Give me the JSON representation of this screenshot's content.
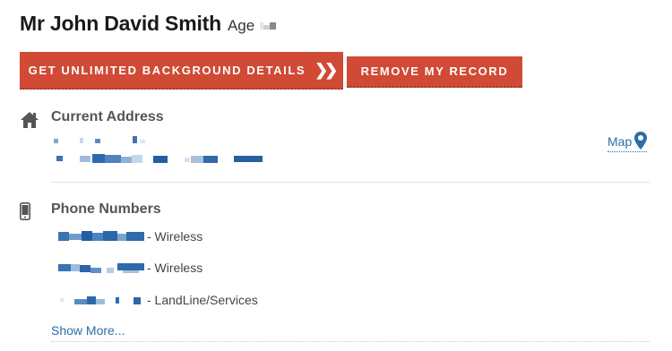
{
  "person": {
    "name": "Mr John David Smith",
    "age_label": "Age"
  },
  "actions": {
    "unlimited_label": "GET UNLIMITED BACKGROUND DETAILS",
    "remove_label": "REMOVE MY RECORD"
  },
  "address_section": {
    "title": "Current Address",
    "map_label": "Map"
  },
  "phone_section": {
    "title": "Phone Numbers",
    "phones": [
      {
        "type": "- Wireless"
      },
      {
        "type": "- Wireless"
      },
      {
        "type": "- LandLine/Services"
      }
    ],
    "show_more_label": "Show More..."
  },
  "colors": {
    "accent_button": "#d04a35",
    "link": "#2a6ea8",
    "redaction": "#2a6ea8"
  },
  "icons": {
    "address": "home-icon",
    "phones": "phone-icon",
    "map": "map-pin-icon",
    "button": "double-chevron-right-icon"
  }
}
